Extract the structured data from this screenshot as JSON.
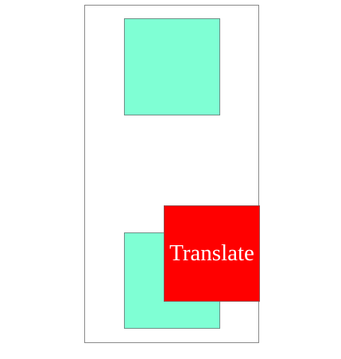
{
  "demo": {
    "translated_label": "Translate",
    "colors": {
      "frame_border": "#8a8a8a",
      "aqua_fill": "#7fffd4",
      "red_fill": "#ff0000",
      "label_text": "#ffffff"
    }
  }
}
